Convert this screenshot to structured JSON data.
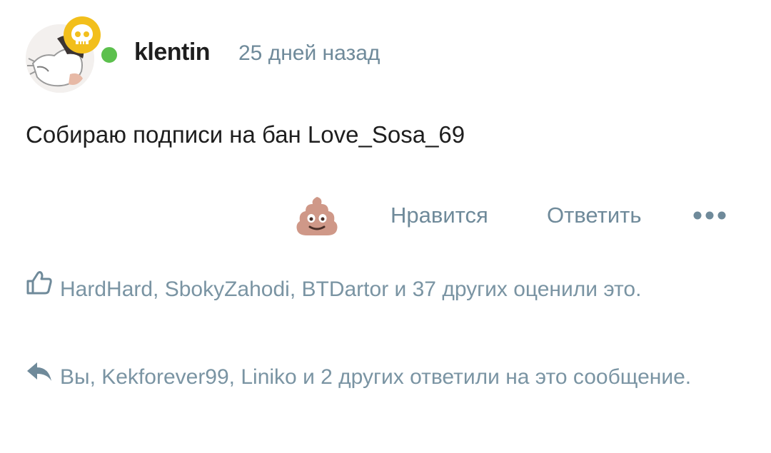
{
  "comment": {
    "author": {
      "username": "klentin",
      "online": true,
      "badge_icon": "skull-icon",
      "badge_color": "#f2bf1c",
      "online_color": "#5cc04d"
    },
    "timestamp": "25 дней назад",
    "text": "Собираю подписи на бан Love_Sosa_69"
  },
  "actions": {
    "reaction_icon": "poop-emoji-icon",
    "like_label": "Нравится",
    "reply_label": "Ответить",
    "more_icon": "more-dots-icon"
  },
  "likes_summary": {
    "icon": "thumbs-up-icon",
    "text": "HardHard, SbokyZahodi, BTDartor и 37 других оценили это."
  },
  "replies_summary": {
    "icon": "reply-arrow-icon",
    "text": "Вы, Kekforever99, Liniko и 2 других ответили на это сообщение."
  },
  "colors": {
    "muted_text": "#6f8a9a",
    "primary_text": "#1e1e1e"
  }
}
